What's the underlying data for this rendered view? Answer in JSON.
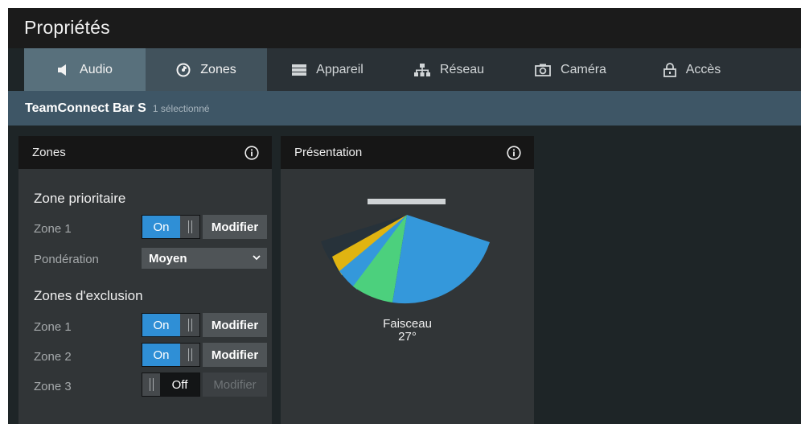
{
  "header": {
    "title": "Propriétés"
  },
  "tabs": [
    {
      "label": "Audio",
      "icon": "speaker-icon"
    },
    {
      "label": "Zones",
      "icon": "zones-icon"
    },
    {
      "label": "Appareil",
      "icon": "device-icon"
    },
    {
      "label": "Réseau",
      "icon": "network-icon"
    },
    {
      "label": "Caméra",
      "icon": "camera-icon"
    },
    {
      "label": "Accès",
      "icon": "lock-icon"
    }
  ],
  "device": {
    "name": "TeamConnect Bar S",
    "selection": "1 sélectionné"
  },
  "zones_panel": {
    "title": "Zones",
    "priority": {
      "title": "Zone prioritaire",
      "zone_label": "Zone 1",
      "toggle_on": "On",
      "modify": "Modifier",
      "weighting_label": "Pondération",
      "weighting_value": "Moyen"
    },
    "exclusion": {
      "title": "Zones d'exclusion",
      "rows": [
        {
          "label": "Zone 1",
          "state": "On",
          "modify": "Modifier"
        },
        {
          "label": "Zone 2",
          "state": "On",
          "modify": "Modifier"
        },
        {
          "label": "Zone 3",
          "state": "Off",
          "modify": "Modifier"
        }
      ]
    }
  },
  "presentation_panel": {
    "title": "Présentation",
    "beam_label": "Faisceau",
    "beam_value": "27°"
  },
  "colors": {
    "accent_blue": "#2f8fd6",
    "zone_blue": "#3498db",
    "zone_green": "#4cd07d",
    "zone_yellow": "#e0b411",
    "zone_dark": "#2c3e50",
    "device_bar": "#3e5666"
  }
}
